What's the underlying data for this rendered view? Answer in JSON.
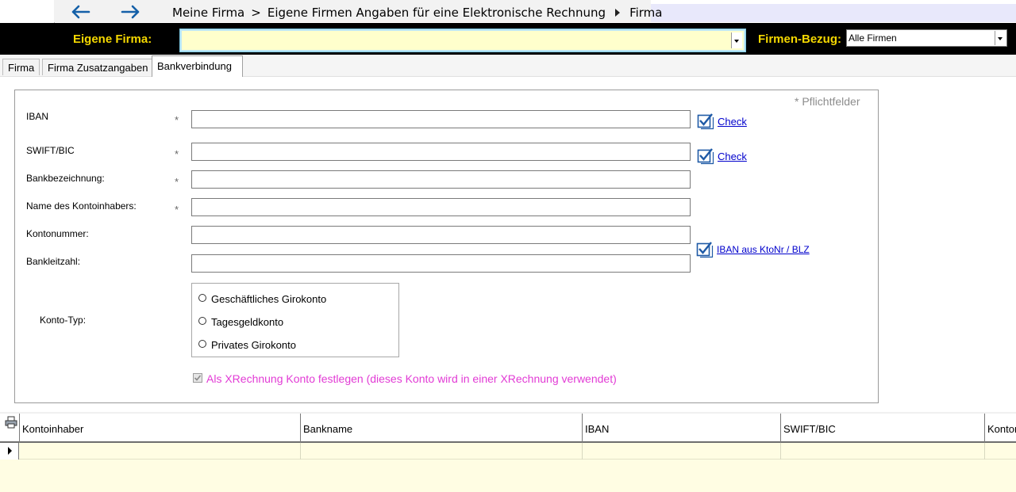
{
  "nav": {
    "back_icon": "arrow-left-icon",
    "forward_icon": "arrow-right-icon",
    "crumb1": "Meine Firma",
    "crumb_sep": ">",
    "crumb2": "Eigene Firmen Angaben für eine Elektronische Rechnung",
    "crumb3": "Firma",
    "arrow_color": "#1560a8"
  },
  "header": {
    "firm_label": "Eigene Firma:",
    "firm_value": "",
    "bezug_label": "Firmen-Bezug:",
    "bezug_value": "Alle Firmen",
    "label_color": "#f5d800"
  },
  "tabs": [
    {
      "label": "Firma",
      "active": false
    },
    {
      "label": "Firma Zusatzangaben",
      "active": false
    },
    {
      "label": "Bankverbindung",
      "active": true
    }
  ],
  "form": {
    "required_note": "* Pflichtfelder",
    "star": "*",
    "fields": {
      "iban": {
        "label": "IBAN",
        "value": "",
        "required": true
      },
      "swift": {
        "label": "SWIFT/BIC",
        "value": "",
        "required": true
      },
      "bankname": {
        "label": "Bankbezeichnung:",
        "value": "",
        "required": true
      },
      "holder": {
        "label": "Name des Kontoinhabers:",
        "value": "",
        "required": true
      },
      "kontonummer": {
        "label": "Kontonummer:",
        "value": "",
        "required": false
      },
      "blz": {
        "label": "Bankleitzahl:",
        "value": "",
        "required": false
      }
    },
    "check_iban": "Check",
    "check_swift": "Check",
    "iban_from": "IBAN aus KtoNr / BLZ",
    "konto_typ_label": "Konto-Typ:",
    "konto_typ_options": [
      "Geschäftliches Girokonto",
      "Tagesgeldkonto",
      "Privates Girokonto"
    ],
    "xrechnung_label": "Als XRechnung Konto festlegen (dieses Konto wird in einer XRechnung verwendet)",
    "xrechnung_checked": true,
    "xrechnung_color": "#e23bd5"
  },
  "grid": {
    "print_icon": "printer-icon",
    "columns": [
      "Kontoinhaber",
      "Bankname",
      "IBAN",
      "SWIFT/BIC",
      "Kontonummer"
    ]
  }
}
